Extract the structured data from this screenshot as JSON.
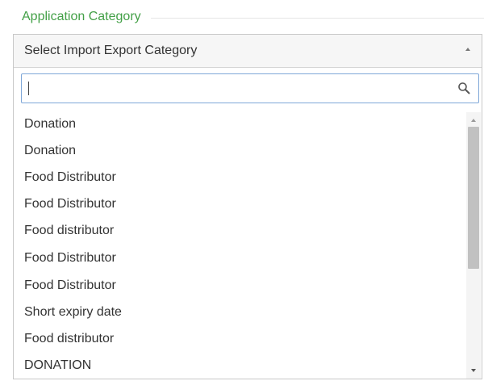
{
  "field": {
    "legend": "Application Category"
  },
  "dropdown": {
    "selected_placeholder": "Select Import Export Category",
    "search": {
      "value": "",
      "placeholder": ""
    },
    "options": [
      "Donation",
      "Donation",
      "Food Distributor",
      "Food Distributor",
      "Food distributor",
      "Food Distributor",
      "Food Distributor",
      "Short expiry date",
      "Food distributor",
      "DONATION"
    ]
  },
  "icons": {
    "header_caret": "chevron-up-icon",
    "search": "search-icon",
    "scroll_up": "scroll-up-arrow-icon",
    "scroll_down": "scroll-down-arrow-icon"
  },
  "colors": {
    "legend": "#43a047",
    "search_border": "#7fa7d8",
    "header_bg": "#f6f6f6",
    "scroll_thumb": "#c1c1c1"
  },
  "scrollbar": {
    "thumb_fraction": 0.55,
    "position_fraction": 0.0
  }
}
